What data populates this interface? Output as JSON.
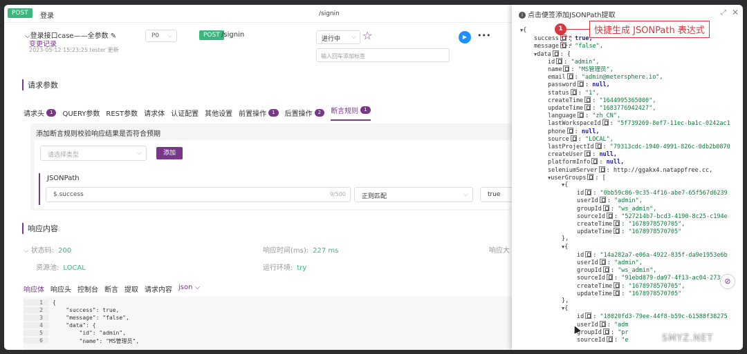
{
  "tab": {
    "method": "POST",
    "title": "登录",
    "url": "/signin"
  },
  "case": {
    "name": "登录接口case——全参数",
    "change_log": "变更记录",
    "updated": "2023-05-12 15:23:25 tester 更新",
    "priority": "P0",
    "method": "POST",
    "path": "/signin",
    "status": "进行中",
    "tag_placeholder": "输入回车添加标签"
  },
  "request": {
    "section_title": "请求参数",
    "tabs": [
      {
        "label": "请求头",
        "badge": "1"
      },
      {
        "label": "QUERY参数",
        "badge": ""
      },
      {
        "label": "REST参数",
        "badge": ""
      },
      {
        "label": "请求体",
        "badge": ""
      },
      {
        "label": "认证配置",
        "badge": ""
      },
      {
        "label": "其他设置",
        "badge": ""
      },
      {
        "label": "前置操作",
        "badge": "1"
      },
      {
        "label": "后置操作",
        "badge": "2"
      },
      {
        "label": "断言规则",
        "badge": "1"
      }
    ]
  },
  "assertion": {
    "hint": "添加断言规则校验响应结果是否符合预期",
    "type_placeholder": "请选择类型",
    "add_label": "添加",
    "jsonpath_label": "JSONPath",
    "expression": "$.success",
    "count": "9/500",
    "match": "正则匹配",
    "expected": "true"
  },
  "response": {
    "section_title": "响应内容",
    "status_label": "状态码:",
    "status_value": "200",
    "time_label": "响应时间(ms):",
    "time_value": "227 ms",
    "size_label": "响应大",
    "pool_label": "资源池:",
    "pool_value": "LOCAL",
    "env_label": "运行环境:",
    "env_value": "try",
    "tabs": [
      "响应体",
      "响应头",
      "控制台",
      "断言",
      "提取",
      "请求内容"
    ],
    "format": "json",
    "code_lines": [
      {
        "n": "1",
        "text": "{"
      },
      {
        "n": "2",
        "text": "    \"success\": true,"
      },
      {
        "n": "3",
        "text": "    \"message\": \"false\","
      },
      {
        "n": "4",
        "text": "    \"data\": {"
      },
      {
        "n": "5",
        "text": "        \"id\": \"admin\","
      },
      {
        "n": "6",
        "text": "        \"name\": \"MS管理员\","
      }
    ]
  },
  "panel": {
    "title": "点击便签添加JSONPath提取",
    "callout_num": "1",
    "callout_text": "快捷生成 JSONPath 表达式",
    "tree": [
      {
        "d": 0,
        "k": "",
        "v": "{",
        "t": "p"
      },
      {
        "d": 1,
        "k": "success",
        "v": "true,",
        "t": "n"
      },
      {
        "d": 1,
        "k": "message",
        "v": "\"false\",",
        "t": "s"
      },
      {
        "d": 1,
        "k": "data",
        "v": "{",
        "t": "p"
      },
      {
        "d": 2,
        "k": "id",
        "v": "\"admin\",",
        "t": "s"
      },
      {
        "d": 2,
        "k": "name",
        "v": "\"MS管理员\",",
        "t": "s"
      },
      {
        "d": 2,
        "k": "email",
        "v": "\"admin@metersphere.io\",",
        "t": "s"
      },
      {
        "d": 2,
        "k": "password",
        "v": "null,",
        "t": "n"
      },
      {
        "d": 2,
        "k": "status",
        "v": "\"1\",",
        "t": "s"
      },
      {
        "d": 2,
        "k": "createTime",
        "v": "\"1644995365000\",",
        "t": "s"
      },
      {
        "d": 2,
        "k": "updateTime",
        "v": "\"1683776942427\",",
        "t": "s"
      },
      {
        "d": 2,
        "k": "language",
        "v": "\"zh_CN\",",
        "t": "s"
      },
      {
        "d": 2,
        "k": "lastWorkspaceId",
        "v": "\"5f739269-8ef7-11ec-ba1c-0242ac1",
        "t": "s"
      },
      {
        "d": 2,
        "k": "phone",
        "v": "null,",
        "t": "n"
      },
      {
        "d": 2,
        "k": "source",
        "v": "\"LOCAL\",",
        "t": "s"
      },
      {
        "d": 2,
        "k": "lastProjectId",
        "v": "\"79313cdc-1940-4991-826c-0db2b0870",
        "t": "s"
      },
      {
        "d": 2,
        "k": "createUser",
        "v": "null,",
        "t": "n"
      },
      {
        "d": 2,
        "k": "platformInfo",
        "v": "null,",
        "t": "n"
      },
      {
        "d": 2,
        "k": "seleniumServer",
        "v": "http://ggakx4.natappfree.cc,",
        "t": "u"
      },
      {
        "d": 2,
        "k": "userGroups",
        "v": "[",
        "t": "p"
      },
      {
        "d": 3,
        "k": "",
        "v": "{",
        "t": "p"
      },
      {
        "d": 4,
        "k": "id",
        "v": "\"0bb59c86-9c35-4f16-abe7-65f567d6239",
        "t": "s"
      },
      {
        "d": 4,
        "k": "userId",
        "v": "\"admin\",",
        "t": "s"
      },
      {
        "d": 4,
        "k": "groupId",
        "v": "\"ws_admin\",",
        "t": "s"
      },
      {
        "d": 4,
        "k": "sourceId",
        "v": "\"527214b7-bcd3-4190-8c25-c194e",
        "t": "s"
      },
      {
        "d": 4,
        "k": "createTime",
        "v": "\"1678978570705\",",
        "t": "s"
      },
      {
        "d": 4,
        "k": "updateTime",
        "v": "\"1678978570705\"",
        "t": "s"
      },
      {
        "d": 3,
        "k": "",
        "v": "},",
        "t": "c"
      },
      {
        "d": 3,
        "k": "",
        "v": "{",
        "t": "p"
      },
      {
        "d": 4,
        "k": "id",
        "v": "\"14a282a7-e06a-4922-835f-da9e1953e6b",
        "t": "s"
      },
      {
        "d": 4,
        "k": "userId",
        "v": "\"admin\",",
        "t": "s"
      },
      {
        "d": 4,
        "k": "groupId",
        "v": "\"ws_admin\",",
        "t": "s"
      },
      {
        "d": 4,
        "k": "sourceId",
        "v": "\"91ebd879-da97-4f13-ac04-273",
        "t": "s"
      },
      {
        "d": 4,
        "k": "createTime",
        "v": "\"1678978570705\",",
        "t": "s"
      },
      {
        "d": 4,
        "k": "updateTime",
        "v": "\"1678978570705\"",
        "t": "s"
      },
      {
        "d": 3,
        "k": "",
        "v": "},",
        "t": "c"
      },
      {
        "d": 3,
        "k": "",
        "v": "{",
        "t": "p"
      },
      {
        "d": 4,
        "k": "id",
        "v": "\"18020fd3-79ee-44f8-b59c-61588f38275",
        "t": "s"
      },
      {
        "d": 4,
        "k": "userId",
        "v": "\"adm",
        "t": "s"
      },
      {
        "d": 4,
        "k": "groupId",
        "v": "\"pr",
        "t": "s"
      },
      {
        "d": 4,
        "k": "sourceId",
        "v": "\"e",
        "t": "s"
      }
    ]
  },
  "watermark": "SMYZ.NET"
}
